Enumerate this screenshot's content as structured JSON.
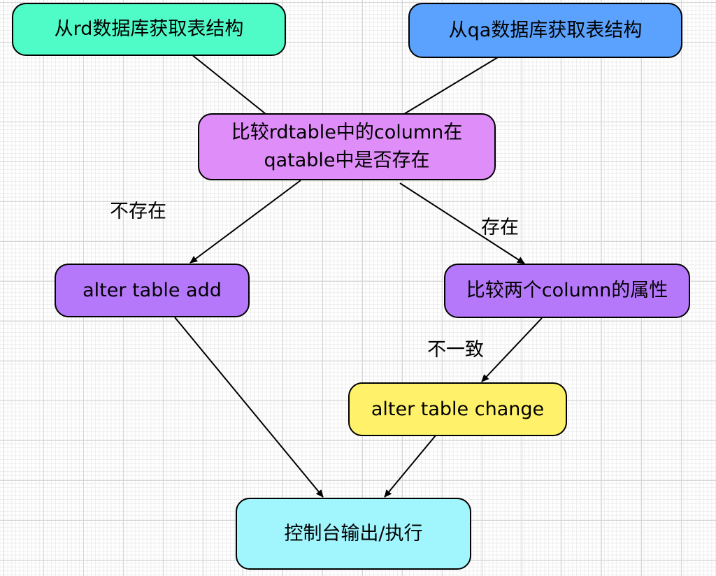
{
  "diagram": {
    "type": "flowchart",
    "nodes": [
      {
        "id": "rd_source",
        "text": "从rd数据库获取表结构",
        "color": "#4ffbc6"
      },
      {
        "id": "qa_source",
        "text": "从qa数据库获取表结构",
        "color": "#5ba2fe"
      },
      {
        "id": "compare_exists",
        "text_line1": "比较rdtable中的column在",
        "text_line2": "qatable中是否存在",
        "color": "#df8df8"
      },
      {
        "id": "alter_add",
        "text": "alter table add",
        "color": "#b678fb"
      },
      {
        "id": "compare_attrs",
        "text": "比较两个column的属性",
        "color": "#b678fb"
      },
      {
        "id": "alter_change",
        "text": "alter table change",
        "color": "#fff26a"
      },
      {
        "id": "output",
        "text": "控制台输出/执行",
        "color": "#a1f6fe"
      }
    ],
    "edges": [
      {
        "from": "rd_source",
        "to": "compare_exists",
        "label": "",
        "arrow": false
      },
      {
        "from": "qa_source",
        "to": "compare_exists",
        "label": "",
        "arrow": false
      },
      {
        "from": "compare_exists",
        "to": "alter_add",
        "label": "不存在",
        "arrow": true
      },
      {
        "from": "compare_exists",
        "to": "compare_attrs",
        "label": "存在",
        "arrow": true
      },
      {
        "from": "compare_attrs",
        "to": "alter_change",
        "label": "不一致",
        "arrow": true
      },
      {
        "from": "alter_add",
        "to": "output",
        "label": "",
        "arrow": true
      },
      {
        "from": "alter_change",
        "to": "output",
        "label": "",
        "arrow": true
      }
    ]
  }
}
